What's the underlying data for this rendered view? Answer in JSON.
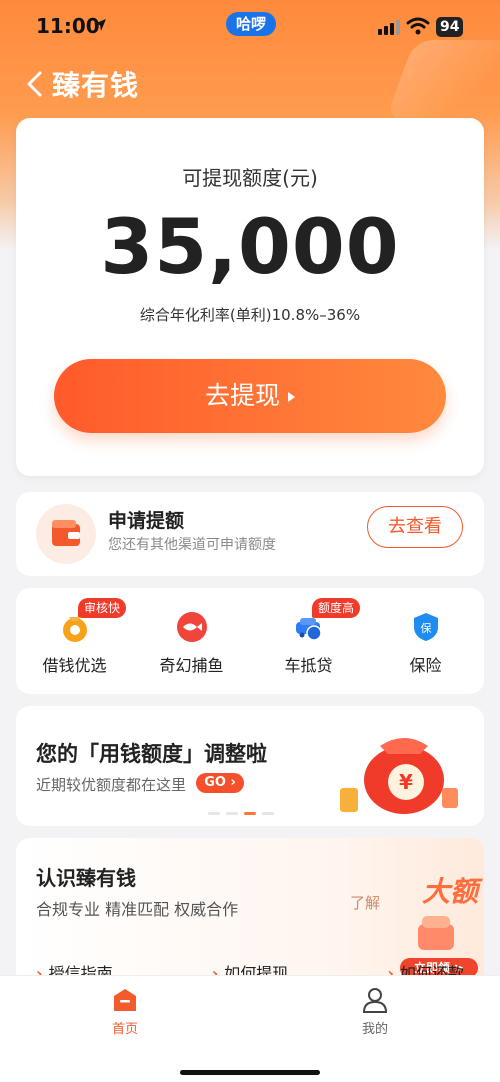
{
  "status": {
    "time": "11:00",
    "app_pill": "哈啰",
    "battery": "94"
  },
  "nav": {
    "title": "臻有钱"
  },
  "quota": {
    "label": "可提现额度(元)",
    "amount": "35,000",
    "rate": "综合年化利率(单利)10.8%–36%",
    "cta": "去提现"
  },
  "apply": {
    "title": "申请提额",
    "subtitle": "您还有其他渠道可申请额度",
    "button": "去查看"
  },
  "shortcuts": [
    {
      "label": "借钱优选",
      "tag": "审核快",
      "icon": "money-bag-icon"
    },
    {
      "label": "奇幻捕鱼",
      "tag": "",
      "icon": "fish-icon"
    },
    {
      "label": "车抵贷",
      "tag": "额度高",
      "icon": "car-icon"
    },
    {
      "label": "保险",
      "tag": "",
      "icon": "shield-icon"
    }
  ],
  "banner": {
    "title": "您的「用钱额度」调整啦",
    "subtitle": "近期较优额度都在这里",
    "go": "GO"
  },
  "know": {
    "title": "认识臻有钱",
    "subtitle": "合规专业 精准匹配 权威合作",
    "links": [
      "授信指南",
      "如何提现",
      "如何还款"
    ],
    "promo_title": "大额",
    "promo_pre": "了解",
    "promo_button": "立即领 >"
  },
  "tabs": [
    {
      "label": "首页",
      "active": true
    },
    {
      "label": "我的",
      "active": false
    }
  ],
  "colors": {
    "accent": "#f35a2c",
    "header": "#ff8a3c"
  }
}
